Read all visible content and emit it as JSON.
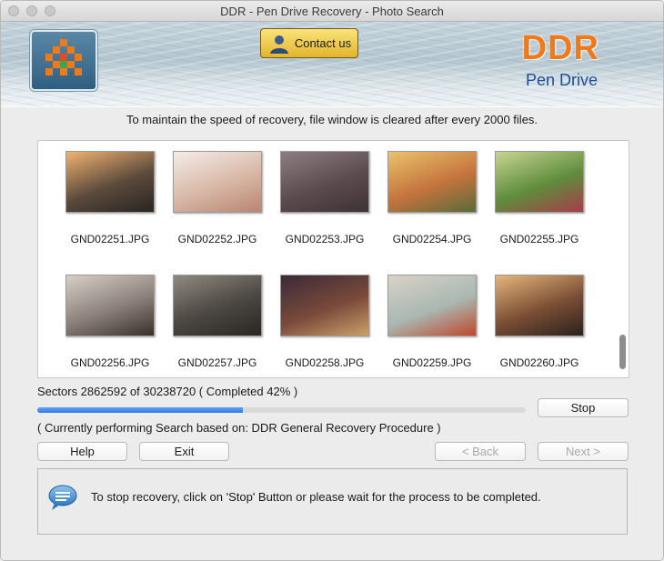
{
  "window": {
    "title": "DDR - Pen Drive Recovery - Photo Search"
  },
  "header": {
    "contact_label": "Contact us",
    "brand_title": "DDR",
    "brand_subtitle": "Pen Drive"
  },
  "notice": "To maintain the speed of recovery, file window is cleared after every 2000 files.",
  "files": [
    {
      "name": "GND02251.JPG",
      "thumb": [
        "#f2b270",
        "#5b4a3c",
        "#2a2522"
      ]
    },
    {
      "name": "GND02252.JPG",
      "thumb": [
        "#f4ede8",
        "#d8b7a6",
        "#b98572"
      ]
    },
    {
      "name": "GND02253.JPG",
      "thumb": [
        "#8d7e82",
        "#5b4b4f",
        "#3d3235"
      ]
    },
    {
      "name": "GND02254.JPG",
      "thumb": [
        "#e9c36a",
        "#c5733d",
        "#5a6b3a"
      ]
    },
    {
      "name": "GND02255.JPG",
      "thumb": [
        "#c7d590",
        "#5f8d3c",
        "#a73c4a"
      ]
    },
    {
      "name": "GND02256.JPG",
      "thumb": [
        "#d7cfc7",
        "#8a8079",
        "#3a302a"
      ]
    },
    {
      "name": "GND02257.JPG",
      "thumb": [
        "#8f8a80",
        "#4a4640",
        "#2a2622"
      ]
    },
    {
      "name": "GND02258.JPG",
      "thumb": [
        "#3a2a38",
        "#7a4a3a",
        "#caa06a"
      ]
    },
    {
      "name": "GND02259.JPG",
      "thumb": [
        "#d9d2c7",
        "#a9b8b2",
        "#c0472c"
      ]
    },
    {
      "name": "GND02260.JPG",
      "thumb": [
        "#e6b57a",
        "#7a4e34",
        "#2b211d"
      ]
    }
  ],
  "progress": {
    "sectors_text": "Sectors 2862592 of 30238720   ( Completed 42% )",
    "fraction": 0.42,
    "status_text": "( Currently performing Search based on: DDR General Recovery Procedure )"
  },
  "buttons": {
    "stop": "Stop",
    "help": "Help",
    "exit": "Exit",
    "back": "< Back",
    "next": "Next >"
  },
  "info": {
    "message": "To stop recovery, click on 'Stop' Button or please wait for the process to be completed."
  },
  "colors": {
    "brand_orange": "#f07a1a",
    "brand_blue": "#1c4f9c",
    "progress_blue": "#2f78e3"
  }
}
